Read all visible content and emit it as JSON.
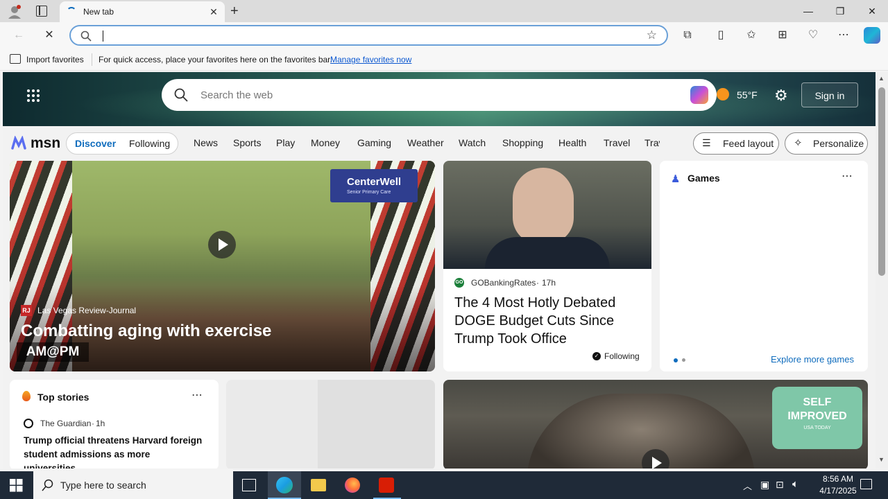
{
  "browser": {
    "tab_title": "New tab",
    "address_value": "",
    "favorites_bar": {
      "import_label": "Import favorites",
      "hint_text": "For quick access, place your favorites here on the favorites bar.",
      "manage_link": "Manage favorites now"
    }
  },
  "msn": {
    "search_placeholder": "Search the web",
    "temperature": "55°F",
    "sign_in": "Sign in",
    "logo_text": "msn",
    "tabs": [
      "Discover",
      "Following"
    ],
    "nav_links": [
      "News",
      "Sports",
      "Play",
      "Money",
      "Gaming",
      "Weather",
      "Watch",
      "Shopping",
      "Health",
      "Travel",
      "Trav"
    ],
    "feed_layout": "Feed layout",
    "personalize": "Personalize"
  },
  "hero_card": {
    "source": "Las Vegas Review-Journal",
    "source_badge": "RJ",
    "headline": "Combatting aging with exercise",
    "watermark": "AM@PM",
    "sponsor": "CenterWell",
    "sponsor_sub": "Senior Primary Care"
  },
  "news_card": {
    "source": "GOBankingRates",
    "source_badge": "GO",
    "age": "17h",
    "headline": "The 4 Most Hotly Debated DOGE Budget Cuts Since Trump Took Office",
    "following": "Following"
  },
  "games_card": {
    "title": "Games",
    "explore": "Explore more games"
  },
  "top_stories": {
    "title": "Top stories",
    "source": "The Guardian",
    "age": "1h",
    "headline": "Trump official threatens Harvard foreign student admissions as more universities..."
  },
  "promo_card": {
    "badge_line1": "SELF",
    "badge_line2": "IMPROVED",
    "badge_line3": "USA TODAY"
  },
  "taskbar": {
    "search_placeholder": "Type here to search",
    "time": "8:56 AM",
    "date": "4/17/2025"
  },
  "colors": {
    "accent": "#0f6cbd",
    "taskbar": "#1f2a38",
    "link": "#0b57d0"
  }
}
